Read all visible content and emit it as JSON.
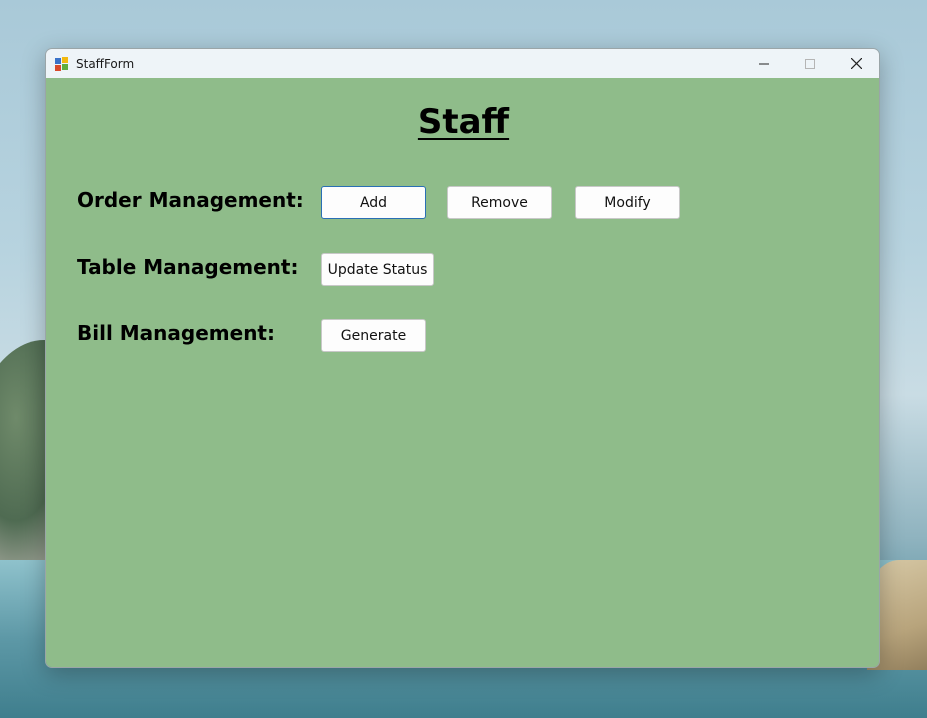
{
  "window": {
    "title": "StaffForm"
  },
  "form": {
    "heading": "Staff",
    "rows": [
      {
        "label": "Order Management:",
        "buttons": [
          "Add",
          "Remove",
          "Modify"
        ]
      },
      {
        "label": "Table Management:",
        "buttons": [
          "Update Status"
        ]
      },
      {
        "label": "Bill Management:",
        "buttons": [
          "Generate"
        ]
      }
    ]
  },
  "colors": {
    "form_background": "#8fbc8a",
    "titlebar_background": "#eef4f8",
    "focus_border": "#2a6fb5"
  },
  "icons": [
    "app-icon",
    "minimize-icon",
    "maximize-icon",
    "close-icon"
  ]
}
